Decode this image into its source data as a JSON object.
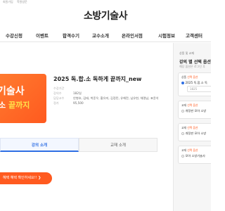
{
  "util_bar": {
    "links": [
      "회원가입",
      "학원방문"
    ]
  },
  "site": {
    "logo": "소방기술사"
  },
  "gnb": {
    "items": [
      "수강신청",
      "이벤트",
      "합격수기",
      "교수소개",
      "온라인서점",
      "시험정보",
      "고객센터"
    ]
  },
  "banner": {
    "line1": "기술사",
    "line2_white": "소 ",
    "line2_yellow": "끝까지"
  },
  "course": {
    "title": "2025 독.합.소 독하게 끝까지_new",
    "meta": [
      {
        "key": "수강기간",
        "value": ""
      },
      {
        "key": "강의수",
        "value": "182일"
      },
      {
        "key": "담당교수",
        "value": "안병호, 김태, 박준우, 황유미, 김정민, 유해란, 남유현, 채명남, 표윤석"
      },
      {
        "key": "정가",
        "value": "95,500"
      }
    ]
  },
  "tabs": {
    "active": "강의 소개",
    "inactive": "교재 소개"
  },
  "promo": {
    "label": "혜택 혜택 확인하세요!! ❯"
  },
  "side": {
    "head": "상품 및 교재",
    "title": "강의 별 선택 옵션",
    "sub": "해당 옵션은 로그인 후",
    "cards": [
      {
        "label": "상품",
        "tag": "선택 옵션",
        "row": "2025 독.합.소 독",
        "price": "1825"
      },
      {
        "label": "교재",
        "tag": "선택 옵션",
        "row": "개정판 모아 소방"
      },
      {
        "label": "교재",
        "tag": "선택 옵션",
        "row": "개정판 모아 소방"
      },
      {
        "label": "교재",
        "tag": "선택 옵션",
        "row": "모아 소방기술사"
      }
    ]
  },
  "colors": {
    "accent": "#2f6fe4",
    "brand": "#ff5a1f",
    "banner_text_yellow": "#ffe14a"
  }
}
